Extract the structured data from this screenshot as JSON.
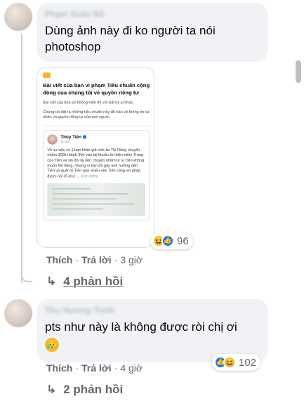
{
  "comment1": {
    "author": "Phạm Xuân Bồ",
    "text_line1": "Dùng ảnh này đi ko người ta nói",
    "text_line2": "photoshop",
    "attachment": {
      "title": "Bài viết của bạn vi phạm Tiêu chuẩn cộng đồng của chúng tôi về quyền riêng tư",
      "para1": "Bài viết của bạn sẽ không hiển thị với bất kỳ ai khác.",
      "para2": "Chúng tôi đặt ra những tiêu chuẩn này để bảo vệ thông tin cá nhân và quyền riêng tư của mọi người.",
      "post_author": "Thủy Tiên",
      "post_time": "11 giờ",
      "post_text": "Về vụ việc có 1 bạn khán giả nick ảo Thi Hồng chuyển nhầm 300k thành 30tr vào tài khoản từ thiện miền Trung của Tiên và xin đòi lại tiền chuyển nhầm là ra Tiên không muốn lên tiếng, nhưng vì bạn đã gây ảnh hưởng đến Tiên và quản lý Tiên quá nhiều nên Tiên cũng xin phép được nói rõ như ...",
      "see_more": "Xem thêm"
    },
    "reactions": {
      "count": "96",
      "icons": [
        "haha-icon",
        "like-icon"
      ]
    },
    "actions": {
      "like": "Thích",
      "reply": "Trả lời",
      "time": "3 giờ"
    },
    "replies": "4 phản hồi"
  },
  "comment2": {
    "author": "Thu Hương Trịnh",
    "text": "pts như này là không được ròi chị ơi",
    "emoji": "😥",
    "reactions": {
      "count": "102",
      "icons": [
        "like-icon",
        "haha-icon"
      ]
    },
    "actions": {
      "like": "Thích",
      "reply": "Trả lời",
      "time": "4 giờ"
    },
    "replies": "2 phản hồi"
  },
  "separator": "·",
  "reply_arrow": "↳",
  "colors": {
    "bubble": "#f0f2f5",
    "meta": "#65676b",
    "like": "#1877f2",
    "haha": "#f7b928"
  }
}
